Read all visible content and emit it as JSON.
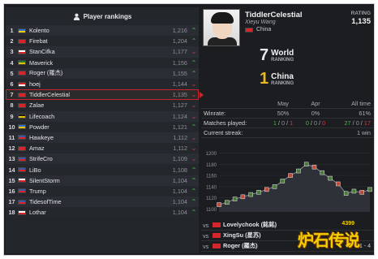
{
  "left_header": "Player rankings",
  "rankings": [
    {
      "rank": "1",
      "flag": [
        "#2f6fd6",
        "#f2d000"
      ],
      "name": "Kolento",
      "rating": "1,216",
      "trend": "up"
    },
    {
      "rank": "2",
      "flag": [
        "#d7262b",
        "#d7262b"
      ],
      "name": "Firebat",
      "rating": "1,204",
      "trend": "up"
    },
    {
      "rank": "3",
      "flag": [
        "#ffffff",
        "#d7262b"
      ],
      "name": "StanCifka",
      "rating": "1,177",
      "trend": "down"
    },
    {
      "rank": "4",
      "flag": [
        "#1d7a2e",
        "#e6c200"
      ],
      "name": "Maverick",
      "rating": "1,156",
      "trend": "up"
    },
    {
      "rank": "5",
      "flag": [
        "#d7262b",
        "#d7262b"
      ],
      "name": "Roger (羅杰)",
      "rating": "1,155",
      "trend": "up"
    },
    {
      "rank": "6",
      "flag": [
        "#d7262b",
        "#ffffff"
      ],
      "name": "hoej",
      "rating": "1,144",
      "trend": "down"
    },
    {
      "rank": "7",
      "flag": [
        "#d7262b",
        "#d7262b"
      ],
      "name": "TiddlerCelestial",
      "rating": "1,135",
      "trend": "down"
    },
    {
      "rank": "8",
      "flag": [
        "#d7262b",
        "#d7262b"
      ],
      "name": "Zalae",
      "rating": "1,127",
      "trend": "down"
    },
    {
      "rank": "9",
      "flag": [
        "#1a1a1a",
        "#e6c200"
      ],
      "name": "Lifecoach",
      "rating": "1,124",
      "trend": "down"
    },
    {
      "rank": "10",
      "flag": [
        "#2f6fd6",
        "#e6c200"
      ],
      "name": "Powder",
      "rating": "1,121",
      "trend": "up"
    },
    {
      "rank": "11",
      "flag": [
        "#3a5aa8",
        "#d7262b"
      ],
      "name": "Hawkeye",
      "rating": "1,112",
      "trend": "down"
    },
    {
      "rank": "12",
      "flag": [
        "#d7262b",
        "#d7262b"
      ],
      "name": "Amaz",
      "rating": "1,112",
      "trend": "down"
    },
    {
      "rank": "13",
      "flag": [
        "#3a5aa8",
        "#d7262b"
      ],
      "name": "StrifeCro",
      "rating": "1,109",
      "trend": "down"
    },
    {
      "rank": "14",
      "flag": [
        "#3a5aa8",
        "#d7262b"
      ],
      "name": "LiBo",
      "rating": "1,108",
      "trend": "up"
    },
    {
      "rank": "15",
      "flag": [
        "#ffffff",
        "#d7262b"
      ],
      "name": "SilentStorm",
      "rating": "1,104",
      "trend": "up"
    },
    {
      "rank": "16",
      "flag": [
        "#3a5aa8",
        "#d7262b"
      ],
      "name": "Trump",
      "rating": "1,104",
      "trend": "up"
    },
    {
      "rank": "17",
      "flag": [
        "#3a5aa8",
        "#d7262b"
      ],
      "name": "TidesofTime",
      "rating": "1,104",
      "trend": "up"
    },
    {
      "rank": "18",
      "flag": [
        "#ffffff",
        "#d7262b"
      ],
      "name": "Lothar",
      "rating": "1,104",
      "trend": "up"
    }
  ],
  "selected_index": 6,
  "profile": {
    "name": "TiddlerCelestial",
    "real_name": "Xieyu Wang",
    "country": "China",
    "rating_label": "RATING",
    "rating": "1,135",
    "world_rank": "7",
    "world_label": "World",
    "world_sub": "RANKING",
    "country_rank": "1",
    "country_label": "China",
    "country_sub": "RANKING"
  },
  "stats": {
    "headers": [
      "",
      "May",
      "Apr",
      "All time"
    ],
    "winrate": {
      "label": "Winrate:",
      "may": "50%",
      "apr": "0%",
      "all": "61%"
    },
    "matches": {
      "label": "Matches played:",
      "may": [
        "1",
        "0",
        "1"
      ],
      "apr": [
        "0",
        "0",
        "0"
      ],
      "all": [
        "27",
        "0",
        "17"
      ]
    },
    "streak": {
      "label": "Current streak:",
      "value": "1 win"
    }
  },
  "chart_data": {
    "type": "line",
    "yticks": [
      1200,
      1180,
      1160,
      1140,
      1120,
      1100
    ],
    "ylim": [
      1095,
      1205
    ],
    "values": [
      1108,
      1112,
      1118,
      1122,
      1126,
      1130,
      1135,
      1140,
      1150,
      1160,
      1168,
      1180,
      1175,
      1165,
      1155,
      1145,
      1128,
      1132,
      1130,
      1135
    ],
    "line_color": "#9aa0a6",
    "fill_color": "#2e3238"
  },
  "matches": [
    {
      "vs": "vs",
      "opponent": "Lovelychook (銘銘)",
      "result": ""
    },
    {
      "vs": "vs",
      "opponent": "XingSu (星苏)",
      "result": ""
    },
    {
      "vs": "vs",
      "opponent": "Roger (羅杰)",
      "result": "1 - 4"
    }
  ],
  "logo": {
    "sub": "4399",
    "main": "炉石传说"
  }
}
